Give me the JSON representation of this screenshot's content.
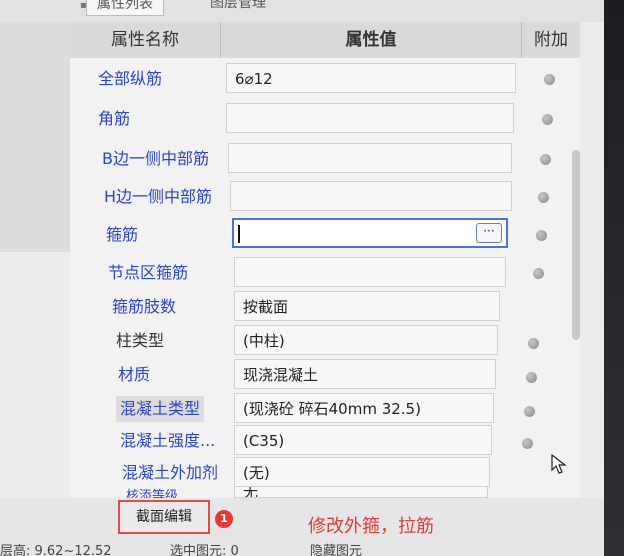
{
  "tabs": [
    {
      "label": "属性列表"
    },
    {
      "label": "图层管理"
    }
  ],
  "header": {
    "name": "属性名称",
    "value": "属性值",
    "extra": "附加"
  },
  "rows": [
    {
      "label": "全部纵筋",
      "value": "6⌀12"
    },
    {
      "label": "角筋",
      "value": ""
    },
    {
      "label": "B边一侧中部筋",
      "value": ""
    },
    {
      "label": "H边一侧中部筋",
      "value": ""
    },
    {
      "label": "箍筋",
      "value": ""
    },
    {
      "label": "节点区箍筋",
      "value": ""
    },
    {
      "label": "箍筋肢数",
      "value": "按截面"
    },
    {
      "label": "柱类型",
      "value": "(中柱)"
    },
    {
      "label": "材质",
      "value": "现浇混凝土"
    },
    {
      "label": "混凝土类型",
      "value": "(现浇砼 碎石40mm 32.5)"
    },
    {
      "label": "混凝土强度...",
      "value": "(C35)"
    },
    {
      "label": "混凝土外加剂",
      "value": "(无)"
    },
    {
      "label": "核添等级",
      "value": "无"
    }
  ],
  "ellipsis": "···",
  "edit_button": "截面编辑",
  "badge": "1",
  "annotation": "修改外箍，拉筋",
  "status": {
    "height": "层高: 9.62~12.52",
    "selected": "选中图元: 0",
    "hidden": "隐藏图元"
  },
  "colors": {
    "label_blue": "#2b45c9",
    "annotation_red": "#e53935",
    "focus_blue": "#4a72d8"
  }
}
